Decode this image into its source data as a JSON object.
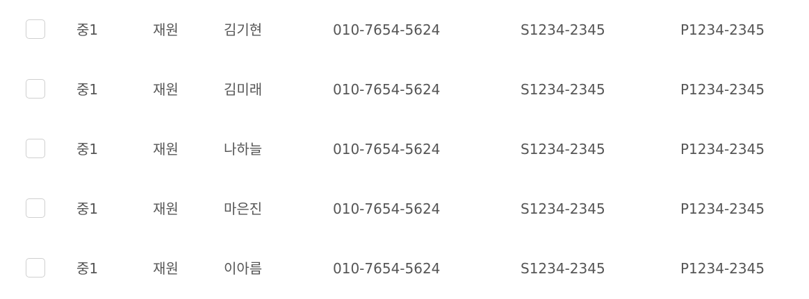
{
  "rows": [
    {
      "grade": "중1",
      "status": "재원",
      "name": "김기현",
      "phone": "010-7654-5624",
      "student_id": "S1234-2345",
      "parent_id": "P1234-2345",
      "checked": false
    },
    {
      "grade": "중1",
      "status": "재원",
      "name": "김미래",
      "phone": "010-7654-5624",
      "student_id": "S1234-2345",
      "parent_id": "P1234-2345",
      "checked": false
    },
    {
      "grade": "중1",
      "status": "재원",
      "name": "나하늘",
      "phone": "010-7654-5624",
      "student_id": "S1234-2345",
      "parent_id": "P1234-2345",
      "checked": false
    },
    {
      "grade": "중1",
      "status": "재원",
      "name": "마은진",
      "phone": "010-7654-5624",
      "student_id": "S1234-2345",
      "parent_id": "P1234-2345",
      "checked": false
    },
    {
      "grade": "중1",
      "status": "재원",
      "name": "이아름",
      "phone": "010-7654-5624",
      "student_id": "S1234-2345",
      "parent_id": "P1234-2345",
      "checked": false
    }
  ],
  "colors": {
    "text": "#555555",
    "checkbox_border": "#cfcfcf",
    "background": "#ffffff"
  }
}
